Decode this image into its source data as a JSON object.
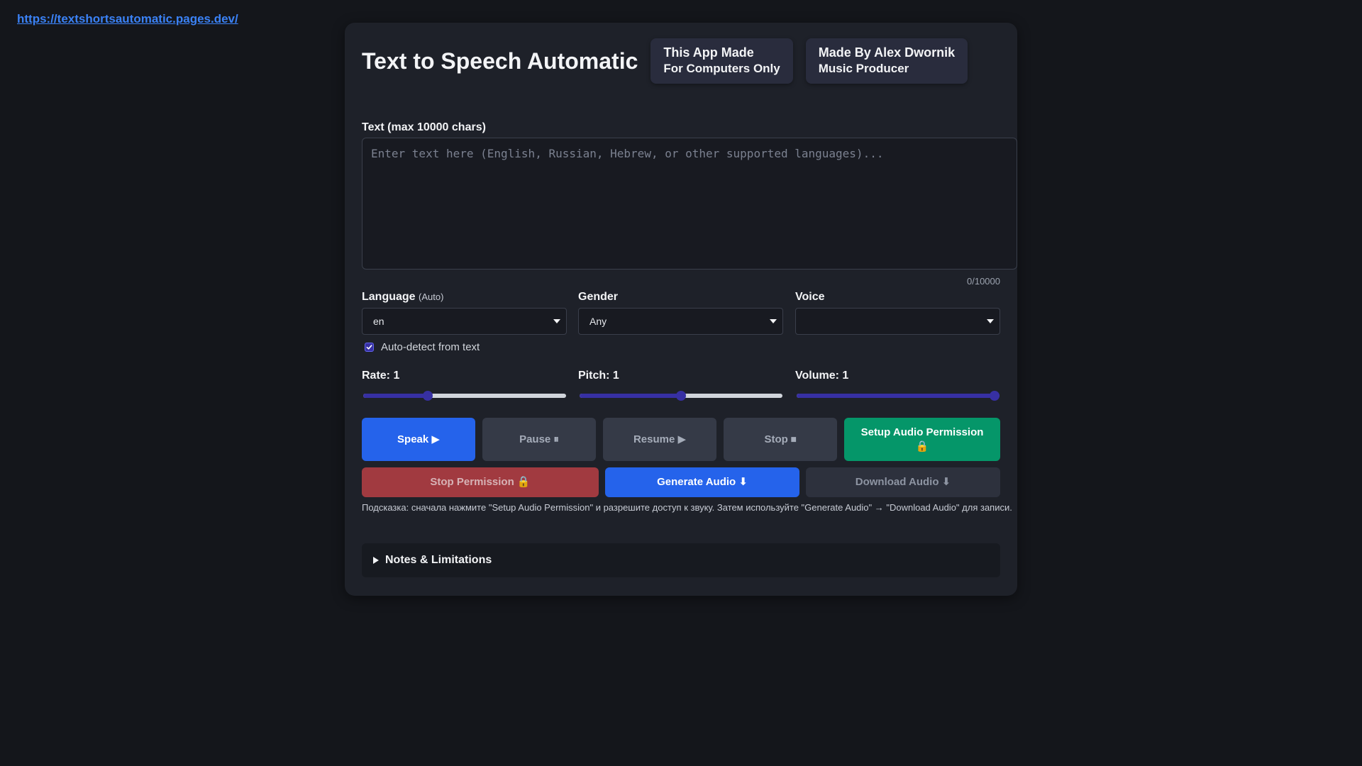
{
  "top_link": "https://textshortsautomatic.pages.dev/",
  "header": {
    "title": "Text to Speech Automatic",
    "badge1": {
      "line1": "This App Made",
      "line2": "For Computers Only"
    },
    "badge2": {
      "line1": "Made By Alex Dwornik",
      "line2": "Music Producer"
    }
  },
  "text_input": {
    "label": "Text (max 10000 chars)",
    "value": "",
    "placeholder": "Enter text here (English, Russian, Hebrew, or other supported languages)...",
    "counter": "0/10000"
  },
  "language": {
    "label": "Language",
    "sublabel": "(Auto)",
    "selected": "en"
  },
  "gender": {
    "label": "Gender",
    "selected": "Any"
  },
  "voice": {
    "label": "Voice",
    "selected": ""
  },
  "auto_detect": {
    "label": "Auto-detect from text",
    "checked": true
  },
  "sliders": {
    "rate": {
      "label": "Rate: 1",
      "value": 1,
      "min": 0.1,
      "max": 3
    },
    "pitch": {
      "label": "Pitch: 1",
      "value": 1,
      "min": 0,
      "max": 2
    },
    "volume": {
      "label": "Volume: 1",
      "value": 1,
      "min": 0,
      "max": 1
    }
  },
  "buttons": {
    "speak": "Speak ▶",
    "pause": "Pause ⏸",
    "resume": "Resume ▶",
    "stop": "Stop ⏹",
    "setup_permission_line1": "Setup Audio Permission",
    "setup_permission_line2": "🔒",
    "stop_permission": "Stop Permission 🔒",
    "generate_audio": "Generate Audio ⬇",
    "download_audio": "Download Audio ⬇"
  },
  "hint": "Подсказка: сначала нажмите \"Setup Audio Permission\" и разрешите доступ к звуку. Затем используйте \"Generate Audio\" → \"Download Audio\" для записи.",
  "notes": {
    "label": "Notes & Limitations"
  },
  "colors": {
    "background": "#14161b",
    "card": "#1e2129",
    "primary": "#2563eb",
    "green": "#059669",
    "red": "#a13a40",
    "slider_fill": "#3730a3",
    "link": "#3b82f6"
  }
}
